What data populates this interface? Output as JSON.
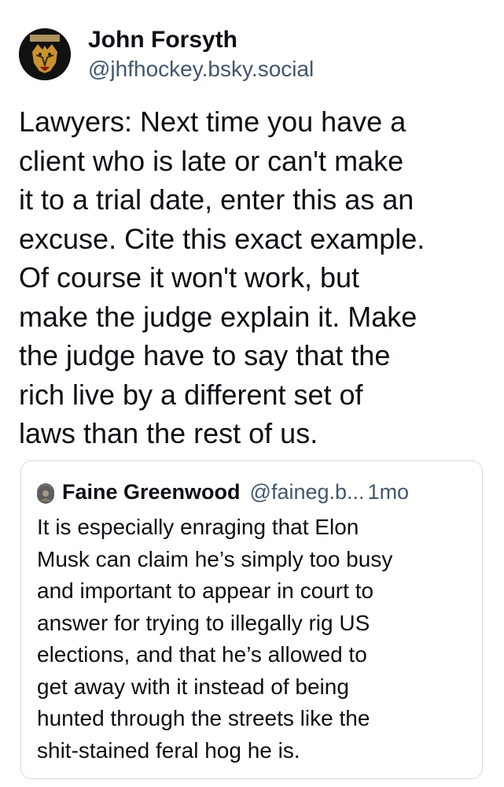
{
  "post": {
    "author": {
      "display_name": "John Forsyth",
      "handle": "@jhfhockey.bsky.social",
      "avatar_icon": "tiger-avatar-icon"
    },
    "text_lines": [
      "Lawyers: Next time you have a",
      "client who is late or can't make",
      "it to a trial date, enter this as an",
      "excuse. Cite this exact example.",
      "Of course it won't work, but",
      "make the judge explain it. Make",
      "the judge have to say that the",
      "rich live by a different set of",
      "laws than the rest of us."
    ]
  },
  "quote": {
    "author": {
      "display_name": "Faine Greenwood",
      "handle": "@faineg.b...",
      "avatar_icon": "user-avatar-icon"
    },
    "time": "1mo",
    "text_lines": [
      "It is especially enraging that Elon",
      "Musk can claim he’s simply too busy",
      "and important to appear in court to",
      "answer for trying to illegally rig US",
      "elections, and that he’s allowed to",
      "get away with it instead of being",
      "hunted through the streets like the",
      "shit-stained feral hog he is."
    ]
  },
  "colors": {
    "text_primary": "#0b0f14",
    "text_secondary": "#42576c",
    "border": "#d4dbe2",
    "background": "#ffffff"
  }
}
